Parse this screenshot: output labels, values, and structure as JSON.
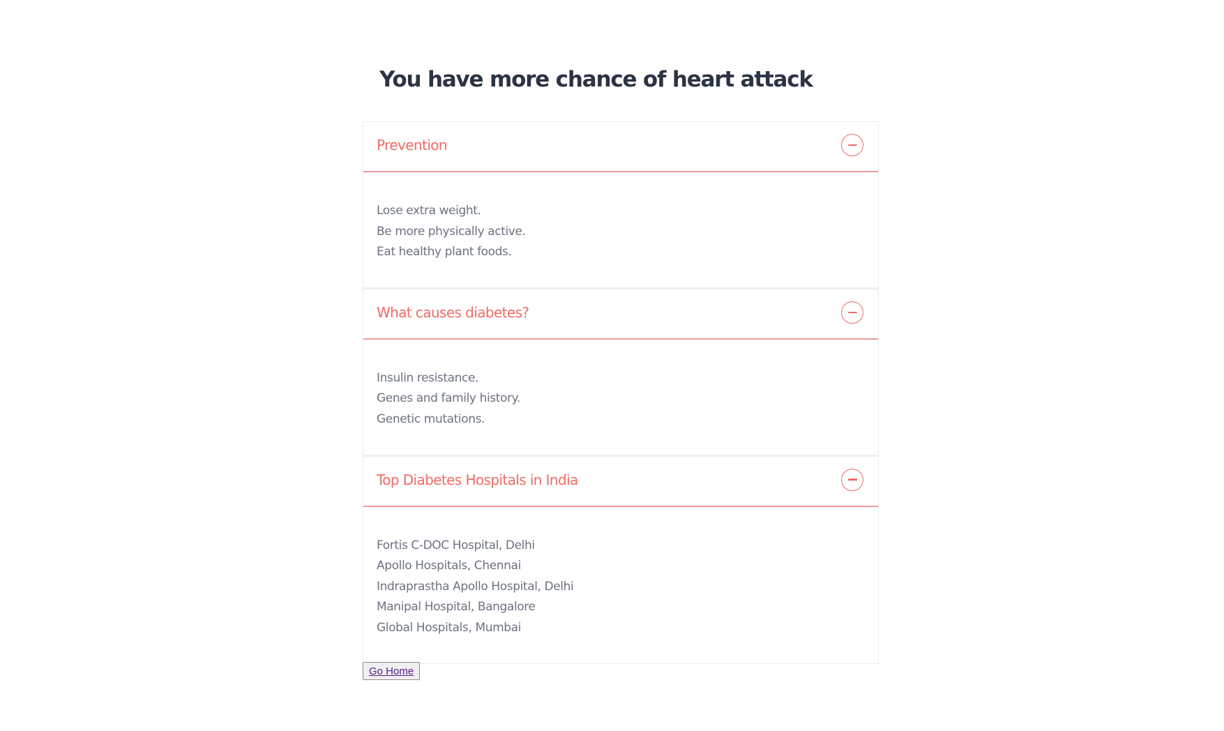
{
  "page": {
    "title": "You have more chance of heart attack"
  },
  "sections": [
    {
      "title": "Prevention",
      "expanded": true,
      "items": [
        "Lose extra weight.",
        "Be more physically active.",
        "Eat healthy plant foods."
      ]
    },
    {
      "title": "What causes diabetes?",
      "expanded": true,
      "items": [
        "Insulin resistance.",
        "Genes and family history.",
        "Genetic mutations."
      ]
    },
    {
      "title": "Top Diabetes Hospitals in India",
      "expanded": true,
      "items": [
        "Fortis C-DOC Hospital, Delhi",
        "Apollo Hospitals, Chennai",
        "Indraprastha Apollo Hospital, Delhi",
        "Manipal Hospital, Bangalore",
        "Global Hospitals, Mumbai"
      ]
    }
  ],
  "footer": {
    "go_home_label": "Go Home"
  },
  "colors": {
    "accent": "#ee6b66",
    "title": "#2b3445",
    "body_text": "#6c7280",
    "divider": "#f09a98"
  },
  "icons": {
    "toggle": "minus-circle-icon"
  }
}
